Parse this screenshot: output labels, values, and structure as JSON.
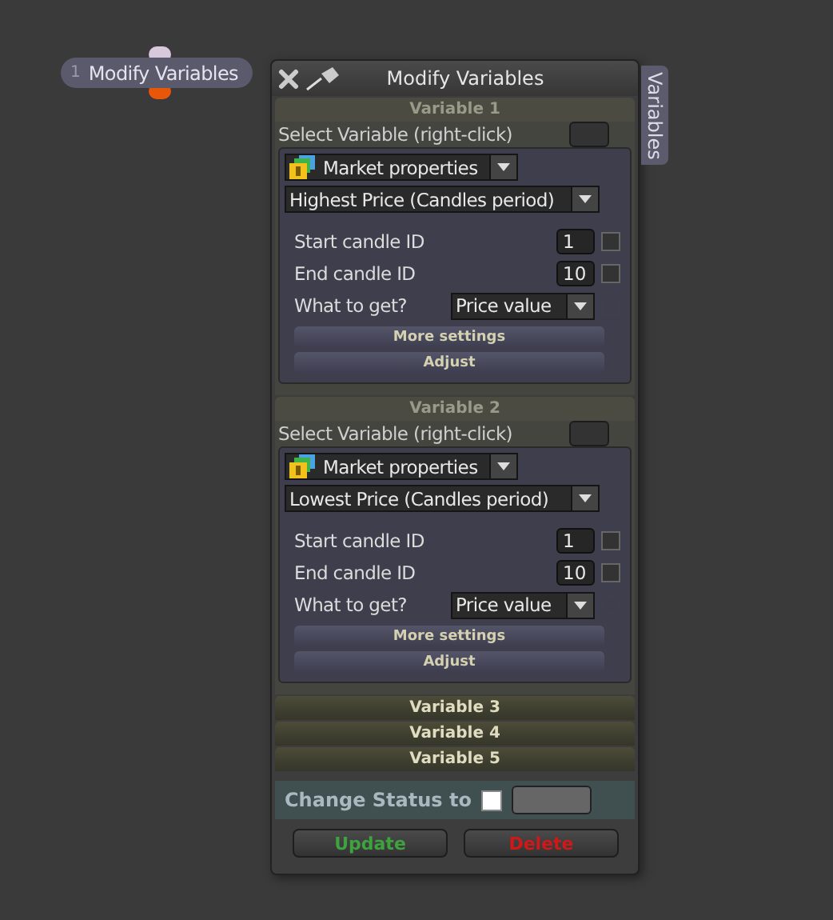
{
  "node": {
    "number": "1",
    "label": "Modify Variables"
  },
  "panel": {
    "title": "Modify Variables",
    "side_tab": "Variables",
    "variables": [
      {
        "title": "Variable 1",
        "expanded": true,
        "select_label": "Select Variable (right-click)",
        "category": "Market properties",
        "function": "Highest Price (Candles period)",
        "fields": [
          {
            "kind": "number",
            "label": "Start candle ID",
            "value": "1",
            "checked": false
          },
          {
            "kind": "number",
            "label": "End candle ID",
            "value": "10",
            "checked": false
          },
          {
            "kind": "select",
            "label": "What to get?",
            "value": "Price value"
          }
        ],
        "buttons": [
          "More settings",
          "Adjust"
        ]
      },
      {
        "title": "Variable 2",
        "expanded": true,
        "select_label": "Select Variable (right-click)",
        "category": "Market properties",
        "function": "Lowest Price (Candles period)",
        "fields": [
          {
            "kind": "number",
            "label": "Start candle ID",
            "value": "1",
            "checked": false
          },
          {
            "kind": "number",
            "label": "End candle ID",
            "value": "10",
            "checked": false
          },
          {
            "kind": "select",
            "label": "What to get?",
            "value": "Price value"
          }
        ],
        "buttons": [
          "More settings",
          "Adjust"
        ]
      },
      {
        "title": "Variable 3",
        "expanded": false
      },
      {
        "title": "Variable 4",
        "expanded": false
      },
      {
        "title": "Variable 5",
        "expanded": false
      }
    ],
    "status": {
      "label": "Change Status to",
      "checked": false
    },
    "actions": [
      {
        "label": "Update",
        "kind": "update"
      },
      {
        "label": "Delete",
        "kind": "delete"
      }
    ]
  }
}
